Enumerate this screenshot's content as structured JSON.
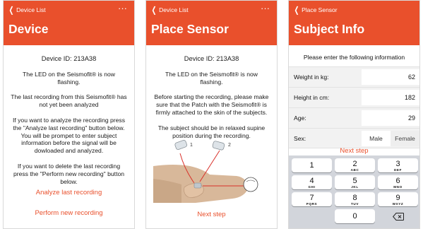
{
  "screen1": {
    "back_label": "Device List",
    "menu_icon": "ellipsis-icon",
    "title": "Device",
    "device_id": "Device ID: 213A38",
    "para1": "The LED on the Seismofit® is now flashing.",
    "para2": "The last recording from this Seismofit® has not yet been analyzed",
    "para3": "If you want to analyze the recording press the \"Analyze last recording\" button below. You will be prompet to enter subject information before the signal will be dowloaded and analyzed.",
    "para4": "If you want to delete the last recording press the \"Perform new recording\" button below.",
    "analyze_button": "Analyze last recording",
    "new_recording_button": "Perform new recording"
  },
  "screen2": {
    "back_label": "Device List",
    "menu_icon": "ellipsis-icon",
    "title": "Place Sensor",
    "device_id": "Device ID: 213A38",
    "para1": "The LED on the Seismofit® is now flashing.",
    "para2": "Before starting the recording, please make sure that the Patch with the Seismofit® is firmly attached to the skin of the subjects.",
    "para3": "The subject should be in relaxed supine position during the recording.",
    "fig_label_1": "1",
    "fig_label_2": "2",
    "next_button": "Next step"
  },
  "screen3": {
    "back_label": "Place Sensor",
    "title": "Subject Info",
    "intro": "Please enter the following information",
    "weight_label": "Weight in kg:",
    "weight_value": "62",
    "height_label": "Height in cm:",
    "height_value": "182",
    "age_label": "Age:",
    "age_value": "29",
    "sex_label": "Sex:",
    "sex_options": [
      "Male",
      "Female"
    ],
    "sex_selected": "Male",
    "next_button": "Next step",
    "keypad": [
      {
        "n": "1",
        "l": ""
      },
      {
        "n": "2",
        "l": "ABC"
      },
      {
        "n": "3",
        "l": "DEF"
      },
      {
        "n": "4",
        "l": "GHI"
      },
      {
        "n": "5",
        "l": "JKL"
      },
      {
        "n": "6",
        "l": "MNO"
      },
      {
        "n": "7",
        "l": "PQRS"
      },
      {
        "n": "8",
        "l": "TUV"
      },
      {
        "n": "9",
        "l": "WXYZ"
      },
      {
        "n": "0",
        "l": ""
      }
    ],
    "delete_icon": "backspace-icon"
  },
  "colors": {
    "accent": "#e9502c",
    "keypad_bg": "#d2d5db"
  }
}
